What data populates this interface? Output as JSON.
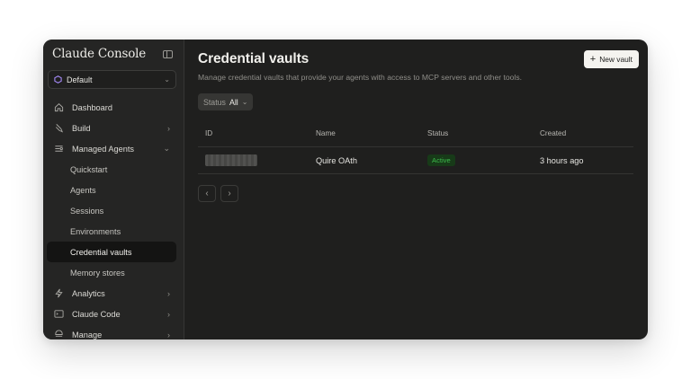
{
  "app": {
    "brand": "Claude Console"
  },
  "workspace": {
    "name": "Default"
  },
  "sidebar": {
    "items": [
      {
        "label": "Dashboard",
        "icon": "home-icon"
      },
      {
        "label": "Build",
        "icon": "build-icon"
      },
      {
        "label": "Managed Agents",
        "icon": "agents-icon"
      }
    ],
    "sub_items": [
      {
        "label": "Quickstart"
      },
      {
        "label": "Agents"
      },
      {
        "label": "Sessions"
      },
      {
        "label": "Environments"
      },
      {
        "label": "Credential vaults",
        "active": true
      },
      {
        "label": "Memory stores"
      }
    ],
    "bottom_items": [
      {
        "label": "Analytics",
        "icon": "analytics-icon"
      },
      {
        "label": "Claude Code",
        "icon": "terminal-icon"
      },
      {
        "label": "Manage",
        "icon": "manage-icon"
      }
    ]
  },
  "main": {
    "title": "Credential vaults",
    "subtitle": "Manage credential vaults that provide your agents with access to MCP servers and other tools.",
    "new_button": "New vault",
    "filter": {
      "label": "Status",
      "value": "All"
    },
    "table": {
      "headers": [
        "ID",
        "Name",
        "Status",
        "Created"
      ],
      "rows": [
        {
          "id": "",
          "name": "Quire OAth",
          "status": "Active",
          "created": "3 hours ago"
        }
      ]
    },
    "pager": {
      "prev_icon": "chevron-left-icon",
      "next_icon": "chevron-right-icon"
    }
  },
  "colors": {
    "window_bg": "#1f1f1e",
    "sidebar_bg": "#252524",
    "active_item_bg": "#141413",
    "status_active": "#3dbb4c",
    "workspace_icon": "#a78bfa"
  }
}
